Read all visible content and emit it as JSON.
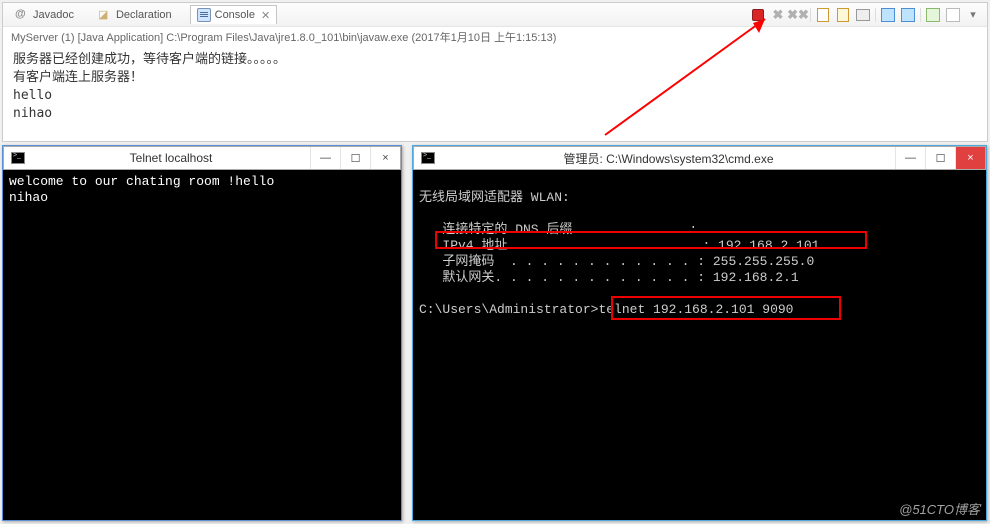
{
  "eclipse": {
    "tabs": {
      "javadoc": "Javadoc",
      "declaration": "Declaration",
      "console": "Console"
    },
    "status": "MyServer (1) [Java Application] C:\\Program Files\\Java\\jre1.8.0_101\\bin\\javaw.exe (2017年1月10日 上午1:15:13)",
    "output": "服务器已经创建成功，等待客户端的链接。。。。。\n有客户端连上服务器！\nhello\nnihao"
  },
  "telnet": {
    "title": "Telnet localhost",
    "buttons": {
      "min": "—",
      "max": "☐",
      "close": "×"
    },
    "content": "welcome to our chating room !hello\nnihao"
  },
  "cmd": {
    "title": "管理员: C:\\Windows\\system32\\cmd.exe",
    "buttons": {
      "min": "—",
      "max": "☐",
      "close": "×"
    },
    "adapter_label": "无线局域网适配器 WLAN:",
    "dns_label": "   连接特定的 DNS 后缀 . . . . . . . :",
    "ipv4_label": "   IPv4 地址 . . . . . . . . . . . . : ",
    "ipv4_value": "192.168.2.101",
    "mask_label": "   子网掩码  . . . . . . . . . . . . : ",
    "mask_value": "255.255.255.0",
    "gw_label": "   默认网关. . . . . . . . . . . . . : ",
    "gw_value": "192.168.2.1",
    "prompt": "C:\\Users\\Administrator>",
    "command": "telnet 192.168.2.101 9090"
  },
  "watermark": "@51CTO博客"
}
